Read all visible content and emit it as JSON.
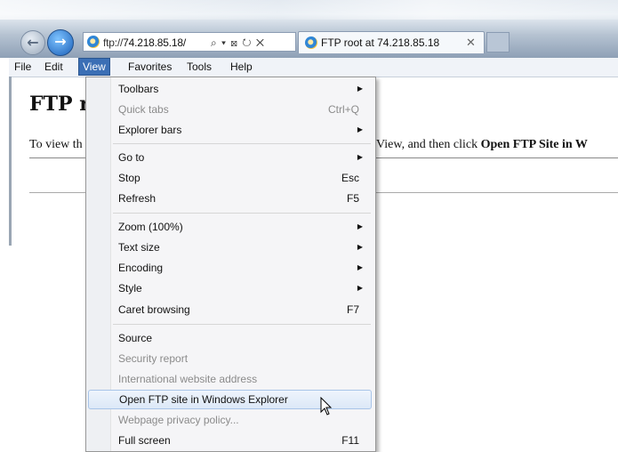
{
  "browser": {
    "address_prefix": "ftp://",
    "address_host": "74.218.85.18/",
    "address_tools": "⌕ ▾ ⊠ ↻ ✕",
    "tab_title": "FTP root at 74.218.85.18",
    "tab_close": "✕"
  },
  "menubar": {
    "file": "File",
    "edit": "Edit",
    "view": "View",
    "favorites": "Favorites",
    "tools": "Tools",
    "help": "Help"
  },
  "page": {
    "heading": "FTP r",
    "text_left": "To view th",
    "text_right_prefix": "View, and then click ",
    "text_right_bold": "Open FTP Site in W"
  },
  "view_menu": {
    "items": [
      {
        "label": "Toolbars",
        "shortcut": "",
        "submenu": true,
        "disabled": false
      },
      {
        "label": "Quick tabs",
        "shortcut": "Ctrl+Q",
        "submenu": false,
        "disabled": true
      },
      {
        "label": "Explorer bars",
        "shortcut": "",
        "submenu": true,
        "disabled": false
      },
      {
        "label": "Go to",
        "shortcut": "",
        "submenu": true,
        "disabled": false
      },
      {
        "label": "Stop",
        "shortcut": "Esc",
        "submenu": false,
        "disabled": false
      },
      {
        "label": "Refresh",
        "shortcut": "F5",
        "submenu": false,
        "disabled": false
      },
      {
        "label": "Zoom (100%)",
        "shortcut": "",
        "submenu": true,
        "disabled": false
      },
      {
        "label": "Text size",
        "shortcut": "",
        "submenu": true,
        "disabled": false
      },
      {
        "label": "Encoding",
        "shortcut": "",
        "submenu": true,
        "disabled": false
      },
      {
        "label": "Style",
        "shortcut": "",
        "submenu": true,
        "disabled": false
      },
      {
        "label": "Caret browsing",
        "shortcut": "F7",
        "submenu": false,
        "disabled": false
      },
      {
        "label": "Source",
        "shortcut": "",
        "submenu": false,
        "disabled": false
      },
      {
        "label": "Security report",
        "shortcut": "",
        "submenu": false,
        "disabled": true
      },
      {
        "label": "International website address",
        "shortcut": "",
        "submenu": false,
        "disabled": true
      },
      {
        "label": "Open FTP site in Windows Explorer",
        "shortcut": "",
        "submenu": false,
        "disabled": false,
        "highlighted": true
      },
      {
        "label": "Webpage privacy policy...",
        "shortcut": "",
        "submenu": false,
        "disabled": true
      },
      {
        "label": "Full screen",
        "shortcut": "F11",
        "submenu": false,
        "disabled": false
      }
    ]
  },
  "colors": {
    "menu_active": "#3b6fb5",
    "hover_border": "#a8c4e8",
    "disabled_text": "#8b8b8b"
  }
}
